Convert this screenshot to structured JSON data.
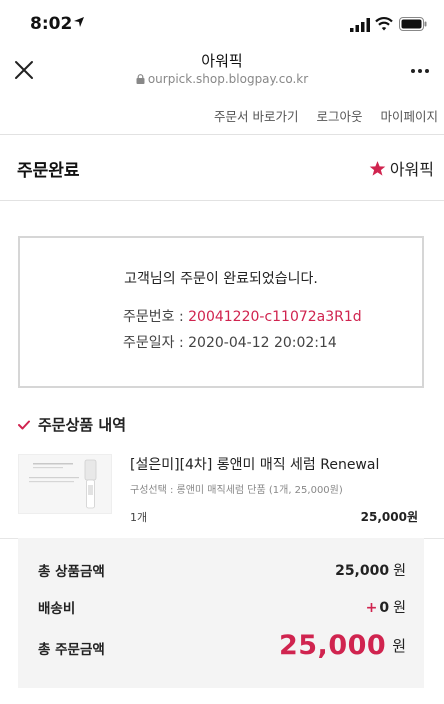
{
  "status": {
    "time": "8:02"
  },
  "browser": {
    "title": "아워픽",
    "url": "ourpick.shop.blogpay.co.kr"
  },
  "subnav": {
    "items": [
      "주문서 바로가기",
      "로그아웃",
      "마이페이지"
    ]
  },
  "header": {
    "title": "주문완료",
    "brand": "아워픽"
  },
  "confirmation": {
    "message": "고객님의 주문이 완료되었습니다.",
    "order_no_label": "주문번호 : ",
    "order_no": "20041220-c11072a3R1d",
    "order_date_label": "주문일자 : ",
    "order_date": "2020-04-12 20:02:14"
  },
  "items_section": {
    "title": "주문상품 내역"
  },
  "product": {
    "name": "[설은미][4차] 롱앤미 매직 세럼 Renewal",
    "option": "구성선택 : 롱앤미 매직세럼 단품 (1개, 25,000원)",
    "qty": "1개",
    "price": "25,000원"
  },
  "summary": {
    "subtotal_label": "총 상품금액",
    "subtotal": "25,000",
    "subtotal_unit": "원",
    "shipping_label": "배송비",
    "shipping": "0",
    "shipping_unit": "원",
    "total_label": "총 주문금액",
    "total": "25,000",
    "total_unit": "원"
  },
  "colors": {
    "accent": "#d0244f"
  }
}
